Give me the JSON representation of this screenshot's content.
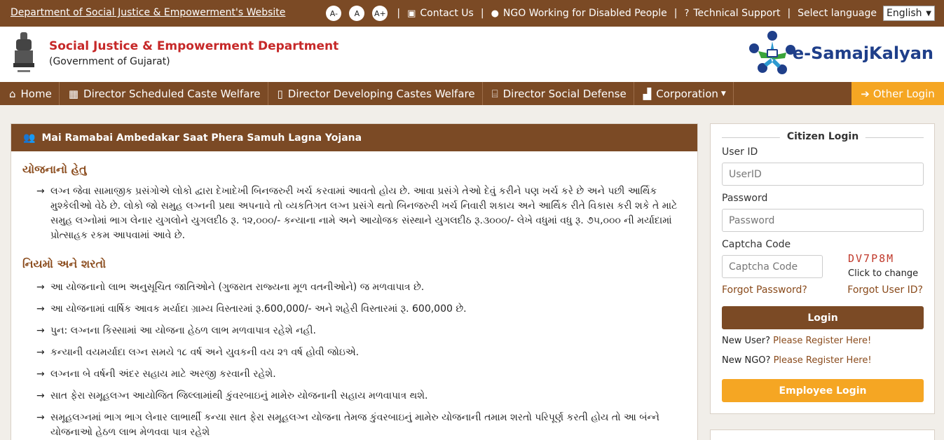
{
  "topbar": {
    "site_link": "Department of Social Justice & Empowerment's Website",
    "font_small": "A-",
    "font_normal": "A",
    "font_large": "A+",
    "contact": "Contact Us",
    "ngo": "NGO Working for Disabled People",
    "support": "Technical Support",
    "lang_label": "Select language",
    "lang_value": "English"
  },
  "header": {
    "title": "Social Justice & Empowerment Department",
    "subtitle": "(Government of Gujarat)",
    "logo_text": "e-SamajKalyan"
  },
  "nav": {
    "items": [
      {
        "label": "Home",
        "icon": "home-icon"
      },
      {
        "label": "Director Scheduled Caste Welfare",
        "icon": "building-icon"
      },
      {
        "label": "Director Developing Castes Welfare",
        "icon": "office-icon"
      },
      {
        "label": "Director Social Defense",
        "icon": "institution-icon"
      },
      {
        "label": "Corporation",
        "icon": "industry-icon"
      }
    ],
    "other_login": "Other Login"
  },
  "scheme": {
    "title": "Mai Ramabai Ambedakar Saat Phera Samuh Lagna Yojana",
    "purpose_heading": "યોજનાનો હેતુ",
    "purpose": [
      "લગ્ન જેવા સામાજીક પ્રસંગોએ લોકો દ્વારા દેખાદેખી બિનજરુરી ખર્ચ કરવામાં આવતો હોય છે. આવા પ્રસંગે તેઓ દેવું કરીને પણ ખર્ચ કરે છે અને પછી આર્થિક મુશ્કેલીઓ વેઠે છે. લોકો જો સમુહ લગ્નની પ્રથા અપનાવે તો વ્યકતિગત લગ્ન પ્રસંગે થતો બિનજરુરી ખર્ચ નિવારી શકાય અને આર્થિક રીતે વિકાસ કરી શકે તે માટે સમુહ લગ્નોમાં ભાગ લેનાર યુગલોને યુગલદીઠ રૂ. ૧૨,૦૦૦/- કન્યાના નામે અને આયોજક સંસ્થાને યુગલદીઠ રૂ.૩૦૦૦/- લેખે વધુમાં વધુ રૂ. ૭૫,૦૦૦ ની મર્યાદામાં પ્રોત્સાહક રકમ આપવામાં આવે છે."
    ],
    "rules_heading": "નિયમો અને શરતો",
    "rules": [
      "આ યોજનાનો લાભ અનુસૂચિત જાતિઓને (ગુજરાત રાજ્યના મૂળ વતનીઓને) જ મળવાપાત્ર છે.",
      "આ યોજનામાં વાર્ષિક આવક મર્યાદા ગ્રામ્ય વિસ્તારમાં રૂ.600,000/- અને શહેરી વિસ્તારમાં રૂ. 600,000 છે.",
      "પુન: લગ્નના કિસ્સામાં આ યોજના હેઠળ લાભ મળવાપાત્ર રહેશે નહી.",
      "કન્યાની વયમર્યાદા લગ્ન સમયે ૧૮ વર્ષ અને યુવકની વય ૨૧ વર્ષ હોવી જોઇએ.",
      "લગ્નના બે વર્ષની અંદર સહાય માટે અરજી કરવાની રહેશે.",
      "સાત ફેરા સમૂહલગ્ન આયોજિત જિલ્લામાંથી કુંવરબાઇનું મામેરુ યોજનાની સહાય મળવાપાત્ર થશે.",
      "સમૂહલગ્નમાં ભાગ ભાગ લેનાર લાભાર્થી કન્યા સાત ફેરા સમૂહલગ્ન યોજના તેમજ કુંવરબાઇનું મામેરુ યોજનાની તમામ શરતો પરિપૂર્ણ કરતી હોય તો આ બંન્ને યોજનાઓ હેઠળ લાભ મેળવવા પાત્ર રહેશે"
    ]
  },
  "login": {
    "title": "Citizen Login",
    "userid_label": "User ID",
    "userid_placeholder": "UserID",
    "password_label": "Password",
    "password_placeholder": "Password",
    "captcha_label": "Captcha Code",
    "captcha_placeholder": "Captcha Code",
    "captcha_text": "DV7P8M",
    "click_to_change": "Click to change",
    "forgot_password": "Forgot Password?",
    "forgot_userid": "Forgot User ID?",
    "login_button": "Login",
    "new_user": "New User?",
    "new_user_link": "Please Register Here!",
    "new_ngo": "New NGO?",
    "new_ngo_link": "Please Register Here!",
    "employee_login": "Employee Login"
  },
  "colors": {
    "brown": "#7b4a25",
    "orange": "#f5a623",
    "red": "#c62828"
  }
}
